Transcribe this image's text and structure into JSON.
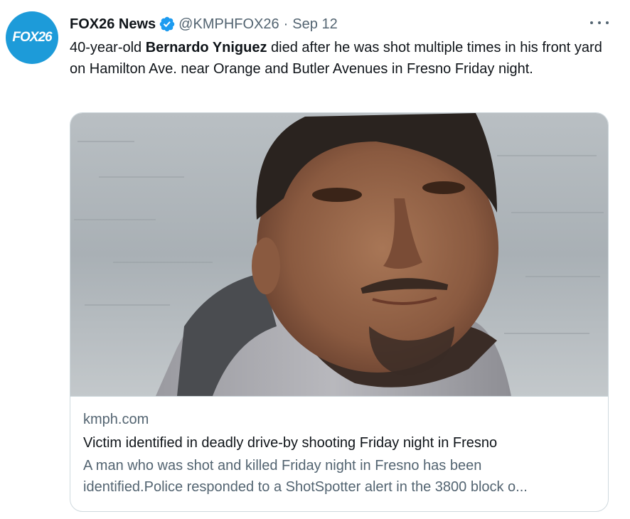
{
  "tweet": {
    "avatar_text": "FOX26",
    "display_name": "FOX26 News",
    "handle": "@KMPHFOX26",
    "separator": "·",
    "date": "Sep 12",
    "more_icon": "ellipsis-icon",
    "body": {
      "prefix": "40-year-old ",
      "bold_name": "Bernardo Yniguez",
      "suffix": " died after he was shot multiple times in his front yard on Hamilton Ave. near Orange and Butler Avenues in Fresno Friday night."
    },
    "card": {
      "domain": "kmph.com",
      "title": "Victim identified in deadly drive-by shooting Friday night in Fresno",
      "description_line1": "A man who was shot and killed Friday night in Fresno has been",
      "description_line2": "identified.Police responded to a ShotSpotter alert in the 3800 block o..."
    },
    "colors": {
      "avatar_bg": "#1d9bd9",
      "verified_badge": "#1d9bf0",
      "secondary_text": "#536471",
      "border": "#cfd9de"
    }
  }
}
